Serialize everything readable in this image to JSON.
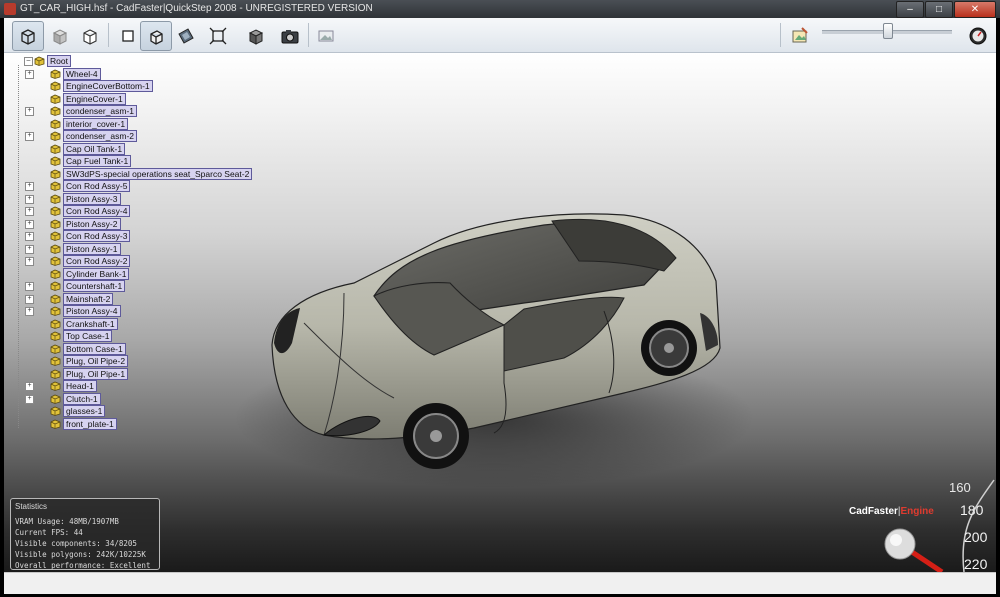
{
  "window": {
    "title": "GT_CAR_HIGH.hsf - CadFaster|QuickStep 2008 - UNREGISTERED VERSION",
    "minimize_glyph": "–",
    "maximize_glyph": "□",
    "close_glyph": "✕"
  },
  "toolbar": {
    "left_icons": [
      "cube-wireframe-icon",
      "cube-shaded-icon",
      "cube-hidden-line-icon",
      "square-icon",
      "cube-perspective-icon",
      "texture-icon",
      "fit-frame-icon",
      "box-solid-icon",
      "camera-icon",
      "image-icon"
    ],
    "right_icons": [
      "background-picker-icon",
      "gauge-icon"
    ],
    "slider_level": 0.5
  },
  "tree": {
    "root": "Root",
    "items": [
      {
        "label": "Wheel-4",
        "expandable": true
      },
      {
        "label": "EngineCoverBottom-1",
        "expandable": false
      },
      {
        "label": "EngineCover-1",
        "expandable": false
      },
      {
        "label": "condenser_asm-1",
        "expandable": true
      },
      {
        "label": "interior_cover-1",
        "expandable": false
      },
      {
        "label": "condenser_asm-2",
        "expandable": true
      },
      {
        "label": "Cap Oil Tank-1",
        "expandable": false
      },
      {
        "label": "Cap Fuel Tank-1",
        "expandable": false
      },
      {
        "label": "SW3dPS-special operations seat_Sparco Seat-2",
        "expandable": false
      },
      {
        "label": "Con Rod Assy-5",
        "expandable": true
      },
      {
        "label": "Piston Assy-3",
        "expandable": true
      },
      {
        "label": "Con Rod Assy-4",
        "expandable": true
      },
      {
        "label": "Piston Assy-2",
        "expandable": true
      },
      {
        "label": "Con Rod Assy-3",
        "expandable": true
      },
      {
        "label": "Piston Assy-1",
        "expandable": true
      },
      {
        "label": "Con Rod Assy-2",
        "expandable": true
      },
      {
        "label": "Cylinder Bank-1",
        "expandable": false
      },
      {
        "label": "Countershaft-1",
        "expandable": true
      },
      {
        "label": "Mainshaft-2",
        "expandable": true
      },
      {
        "label": "Piston Assy-4",
        "expandable": true
      },
      {
        "label": "Crankshaft-1",
        "expandable": false
      },
      {
        "label": "Top Case-1",
        "expandable": false
      },
      {
        "label": "Bottom Case-1",
        "expandable": false
      },
      {
        "label": "Plug, Oil Pipe-2",
        "expandable": false
      },
      {
        "label": "Plug, Oil Pipe-1",
        "expandable": false
      },
      {
        "label": "Head-1",
        "expandable": true
      },
      {
        "label": "Clutch-1",
        "expandable": true
      },
      {
        "label": "glasses-1",
        "expandable": false
      },
      {
        "label": "front_plate-1",
        "expandable": false
      }
    ]
  },
  "stats": {
    "title": "Statistics",
    "vram": "VRAM Usage: 48MB/1907MB",
    "fps": "Current FPS: 44",
    "components": "Visible components: 34/8205",
    "polygons": "Visible polygons: 242K/10225K",
    "performance": "Overall performance: Excellent"
  },
  "brand": {
    "name": "CadFaster",
    "separator": "|",
    "engine": "Engine"
  },
  "speedometer": {
    "ticks": [
      "160",
      "180",
      "200",
      "220"
    ]
  },
  "colors": {
    "engine_red": "#e03b2f",
    "tree_label_bg": "#d7d3f0",
    "tree_label_border": "#5e5a9a"
  }
}
